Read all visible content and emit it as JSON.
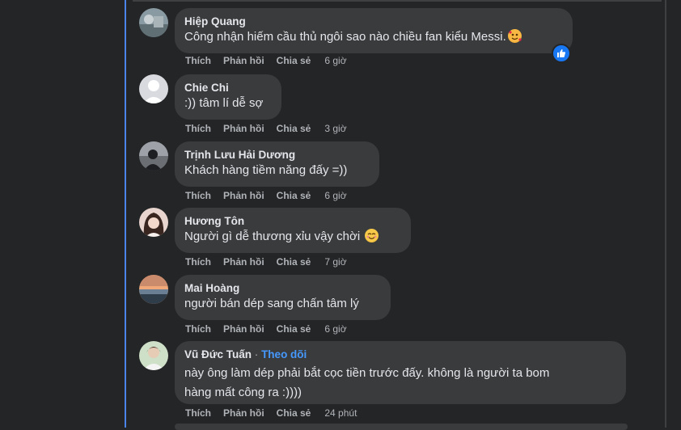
{
  "comments": [
    {
      "name": "Hiệp Quang",
      "text": "Công nhận hiếm cầu thủ ngôi sao nào chiều fan kiểu Messi.",
      "emoji_icon": "smiling-face-with-hearts-icon",
      "reaction_icon": "like-reaction-icon",
      "actions": {
        "like": "Thích",
        "reply": "Phản hồi",
        "share": "Chia sẻ",
        "time": "6 giờ"
      }
    },
    {
      "name": "Chie Chi",
      "text": ":)) tâm lí dễ sợ",
      "actions": {
        "like": "Thích",
        "reply": "Phản hồi",
        "share": "Chia sẻ",
        "time": "3 giờ"
      }
    },
    {
      "name": "Trịnh Lưu Hải Dương",
      "text": "Khách hàng tiềm năng đấy =))",
      "actions": {
        "like": "Thích",
        "reply": "Phản hồi",
        "share": "Chia sẻ",
        "time": "6 giờ"
      }
    },
    {
      "name": "Hương Tôn",
      "text": "Người gì dễ thương xỉu vậy chời",
      "emoji_icon": "smiling-face-icon",
      "actions": {
        "like": "Thích",
        "reply": "Phản hồi",
        "share": "Chia sẻ",
        "time": "7 giờ"
      }
    },
    {
      "name": "Mai Hoàng",
      "text": "người bán dép sang chấn tâm lý",
      "actions": {
        "like": "Thích",
        "reply": "Phản hồi",
        "share": "Chia sẻ",
        "time": "6 giờ"
      }
    },
    {
      "name": "Vũ Đức Tuấn",
      "separator": "·",
      "follow": "Theo dõi",
      "text_line1": "này ông làm dép phải bắt cọc tiền trước đấy. không là người ta bom",
      "text_line2": "hàng mất công ra :))))",
      "actions": {
        "like": "Thích",
        "reply": "Phản hồi",
        "share": "Chia sẻ",
        "time": "24 phút"
      }
    }
  ],
  "colors": {
    "background": "#242526",
    "bubble": "#3a3b3c",
    "thread_line": "#4b84e8",
    "link": "#4599ff"
  }
}
